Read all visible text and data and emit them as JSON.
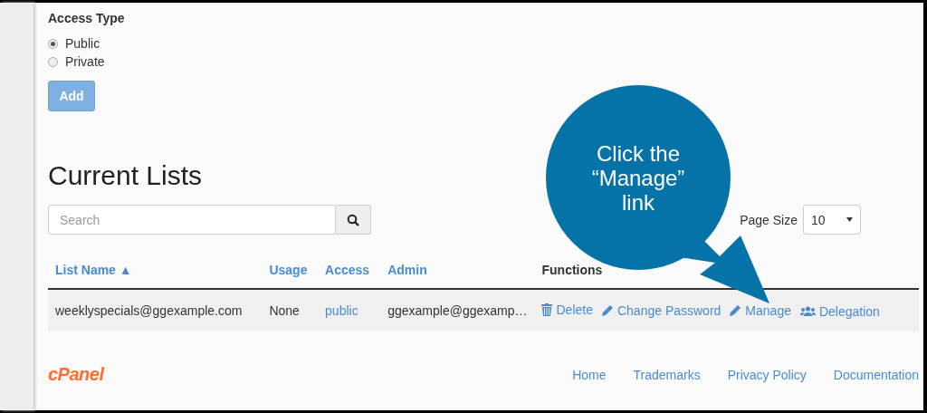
{
  "access_type": {
    "label": "Access Type",
    "options": [
      {
        "label": "Public",
        "selected": true
      },
      {
        "label": "Private",
        "selected": false
      }
    ]
  },
  "add_button": "Add",
  "section_title": "Current Lists",
  "search": {
    "placeholder": "Search"
  },
  "page_size": {
    "label": "Page Size",
    "value": "10"
  },
  "table": {
    "columns": [
      {
        "label": "List Name",
        "sort_indicator": "▲"
      },
      {
        "label": "Usage"
      },
      {
        "label": "Access"
      },
      {
        "label": "Admin"
      },
      {
        "label": "Functions"
      }
    ],
    "rows": [
      {
        "list_name": "weeklyspecials@ggexample.com",
        "usage": "None",
        "access": "public",
        "admin": "ggexample@ggexamp…",
        "functions": [
          {
            "kind": "delete",
            "label": "Delete"
          },
          {
            "kind": "edit",
            "label": "Change Password"
          },
          {
            "kind": "edit",
            "label": "Manage"
          },
          {
            "kind": "users",
            "label": "Delegation"
          }
        ]
      }
    ]
  },
  "callout": {
    "lines": [
      "Click the",
      "“Manage”",
      "link"
    ]
  },
  "footer": {
    "logo": "cPanel",
    "links": [
      "Home",
      "Trademarks",
      "Privacy Policy",
      "Documentation"
    ]
  }
}
